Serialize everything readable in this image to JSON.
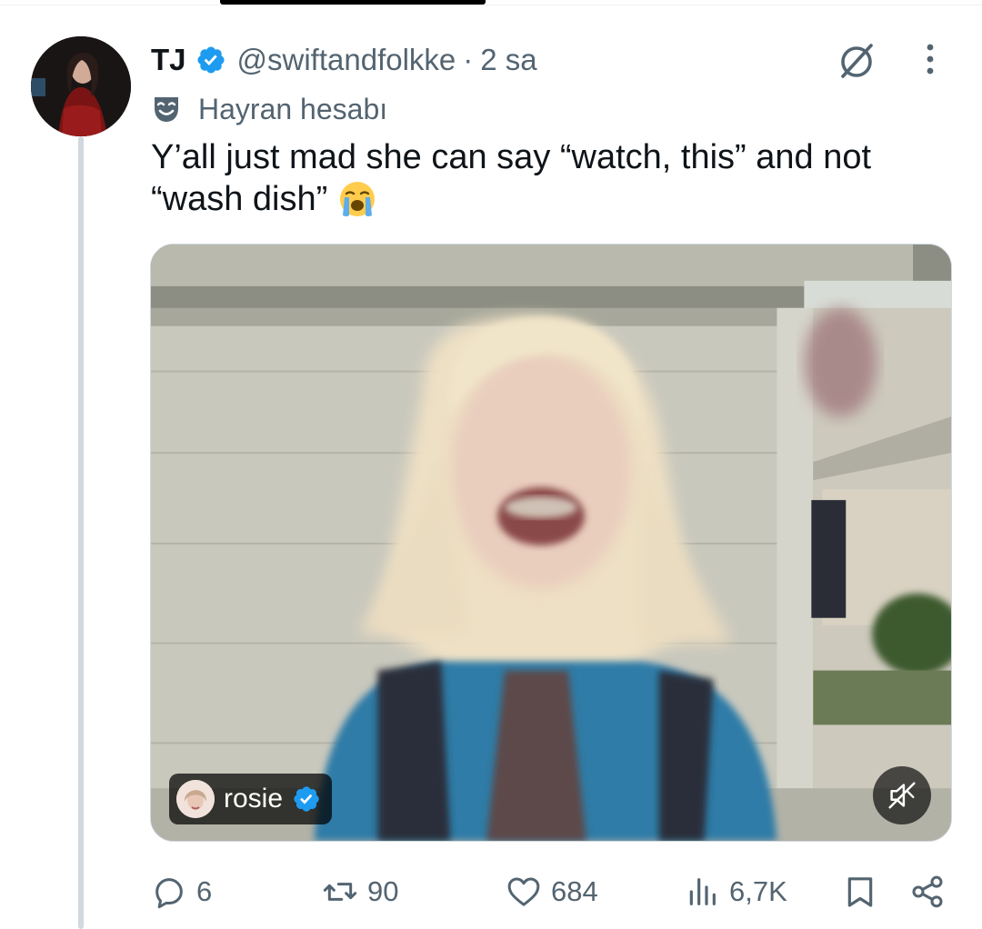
{
  "tweet": {
    "display_name": "TJ",
    "handle": "@swiftandfolkke",
    "separator": "·",
    "time": "2 sa",
    "fan_label": "Hayran hesabı",
    "text": "Y’all just mad she can say “watch, this” and not “wash dish”",
    "emoji": "loudly-crying-face"
  },
  "media": {
    "creator_name": "rosie",
    "muted": true
  },
  "actions": {
    "replies": "6",
    "reposts": "90",
    "likes": "684",
    "views": "6,7K"
  },
  "colors": {
    "verified": "#1d9bf0",
    "text_primary": "#0f1419",
    "text_secondary": "#536471",
    "thread_line": "#cfd9de"
  }
}
